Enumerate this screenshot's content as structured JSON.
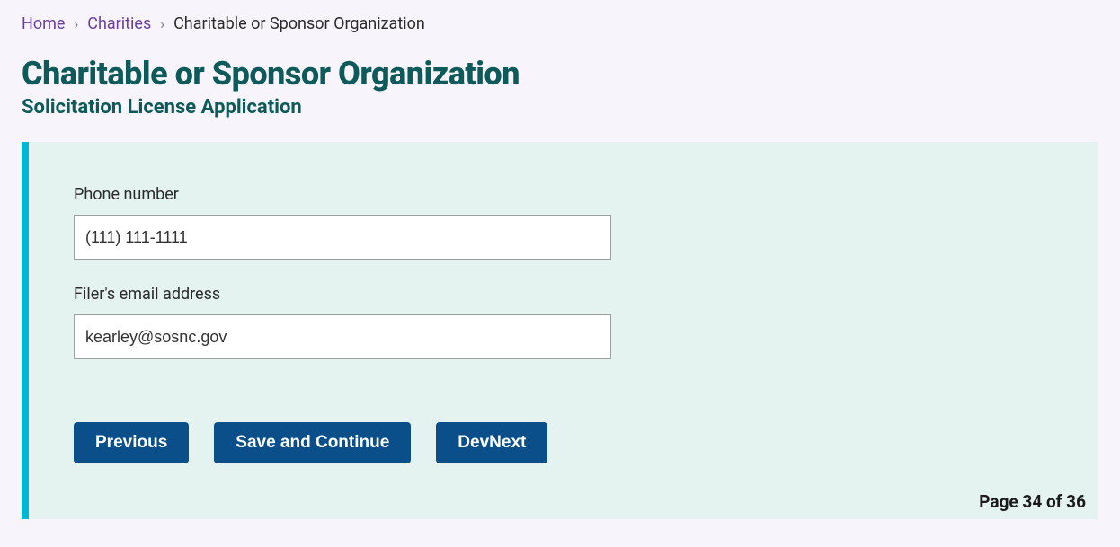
{
  "breadcrumb": {
    "home": "Home",
    "charities": "Charities",
    "current": "Charitable or Sponsor Organization"
  },
  "header": {
    "title": "Charitable or Sponsor Organization",
    "subtitle": "Solicitation License Application"
  },
  "form": {
    "phone": {
      "label": "Phone number",
      "value": "(111) 111-1111"
    },
    "email": {
      "label": "Filer's email address",
      "value": "kearley@sosnc.gov"
    }
  },
  "buttons": {
    "previous": "Previous",
    "save_continue": "Save and Continue",
    "devnext": "DevNext"
  },
  "pagination": {
    "text": "Page 34 of 36"
  }
}
